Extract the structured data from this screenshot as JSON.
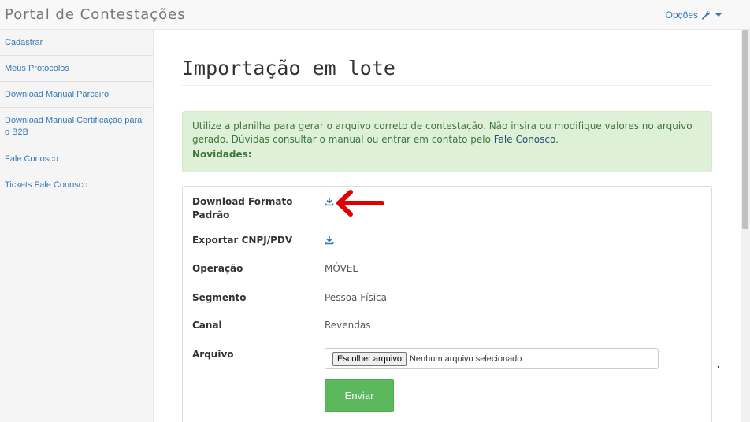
{
  "header": {
    "brand": "Portal de Contestações",
    "options_label": "Opções"
  },
  "sidebar": {
    "items": [
      {
        "label": "Cadastrar"
      },
      {
        "label": "Meus Protocolos"
      },
      {
        "label": "Download Manual Parceiro"
      },
      {
        "label": "Download Manual Certificação para o B2B"
      },
      {
        "label": "Fale Conosco"
      },
      {
        "label": "Tickets Fale Conosco"
      }
    ]
  },
  "main": {
    "title": "Importação em lote",
    "alert": {
      "text": "Utilize a planilha para gerar o arquivo correto de contestação. Não insira ou modifique valores no arquivo gerado. Dúvidas consultar o manual ou entrar em contato pelo ",
      "link": "Fale Conosco",
      "suffix": ".",
      "news": "Novidades:"
    },
    "form": {
      "download_label": "Download Formato Padrão",
      "export_label": "Exportar CNPJ/PDV",
      "operation_label": "Operação",
      "operation_value": "MÓVEL",
      "segment_label": "Segmento",
      "segment_value": "Pessoa Física",
      "channel_label": "Canal",
      "channel_value": "Revendas",
      "file_label": "Arquivo",
      "file_button": "Escolher arquivo",
      "file_status": "Nenhum arquivo selecionado",
      "submit": "Enviar"
    }
  },
  "colors": {
    "link": "#337ab7",
    "alert_bg": "#dff0d8",
    "alert_text": "#3c763d",
    "submit_bg": "#5cb85c",
    "annotation_arrow": "#e00000"
  },
  "icons": {
    "options": "wrench-icon",
    "download": "download-icon",
    "annotation": "red-arrow"
  }
}
